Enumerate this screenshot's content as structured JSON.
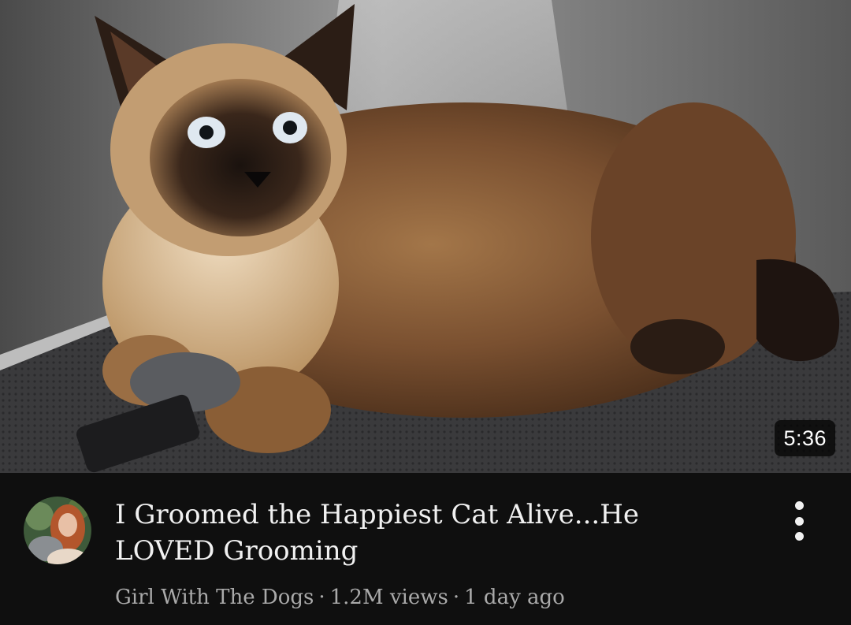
{
  "video": {
    "duration": "5:36",
    "title": "I Groomed the Happiest Cat Alive...He LOVED Grooming",
    "channel": "Girl With The Dogs",
    "views": "1.2M views",
    "age": "1 day ago",
    "separator": "·"
  },
  "icons": {
    "more": "more-vert-icon"
  },
  "colors": {
    "background": "#0f0f0f",
    "title": "#f1f1f1",
    "meta_text": "#aaaaaa"
  }
}
